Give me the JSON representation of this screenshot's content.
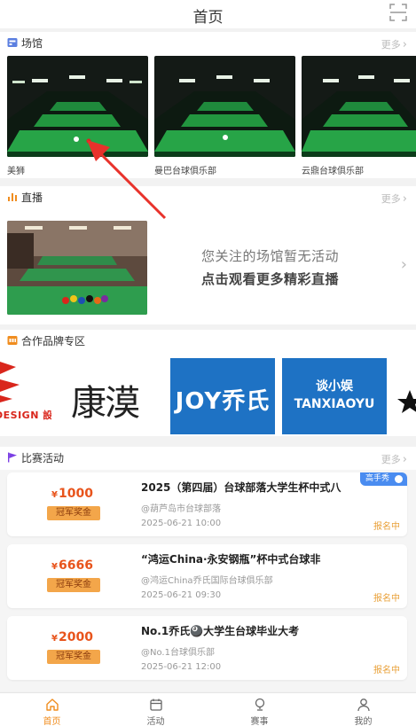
{
  "header": {
    "title": "首页"
  },
  "venues": {
    "heading": "场馆",
    "more": "更多",
    "items": [
      {
        "name": "美狮"
      },
      {
        "name": "曼巴台球俱乐部"
      },
      {
        "name": "云鼎台球俱乐部"
      }
    ]
  },
  "live": {
    "heading": "直播",
    "more": "更多",
    "message_line1": "您关注的场馆暂无活动",
    "message_line2": "点击观看更多精彩直播"
  },
  "brands": {
    "heading": "合作品牌专区",
    "items": [
      {
        "name": "DESIGN 設計"
      },
      {
        "name": "康漠"
      },
      {
        "name": "JOY乔氏"
      },
      {
        "name": "谈小娱 TANXIAOYU"
      }
    ]
  },
  "events": {
    "heading": "比赛活动",
    "more": "更多",
    "items": [
      {
        "currency": "¥",
        "amount": "1000",
        "badge": "冠军奖金",
        "title": "2025（第四届）台球部落大学生杯中式八",
        "organizer": "@葫芦岛市台球部落",
        "date": "2025-06-21 10:00",
        "status": "报名中",
        "tag": "高手秀"
      },
      {
        "currency": "¥",
        "amount": "6666",
        "badge": "冠军奖金",
        "title": "“鸿运China·永安钢瓶”杯中式台球非",
        "organizer": "@鸿运China乔氏国际台球俱乐部",
        "date": "2025-06-21 09:30",
        "status": "报名中",
        "tag": ""
      },
      {
        "currency": "¥",
        "amount": "2000",
        "badge": "冠军奖金",
        "title": "No.1乔氏🎱大学生台球毕业大考",
        "organizer": "@No.1台球俱乐部",
        "date": "2025-06-21 12:00",
        "status": "报名中",
        "tag": ""
      }
    ]
  },
  "nav": {
    "items": [
      {
        "label": "首页",
        "icon": "home-icon",
        "active": true
      },
      {
        "label": "活动",
        "icon": "calendar-icon",
        "active": false
      },
      {
        "label": "赛事",
        "icon": "trophy-icon",
        "active": false
      },
      {
        "label": "我的",
        "icon": "user-icon",
        "active": false
      }
    ]
  },
  "colors": {
    "accent": "#f08d1f",
    "prize": "#e8541c",
    "badge": "#f3a64a",
    "tag": "#4a8cf0",
    "status": "#e9a13a"
  }
}
